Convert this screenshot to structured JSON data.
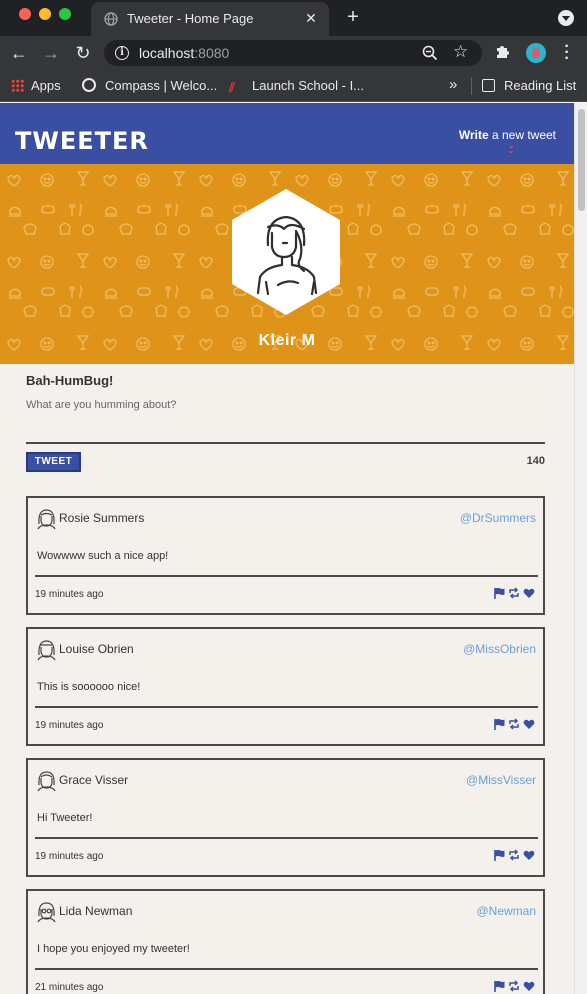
{
  "browser": {
    "tab_title": "Tweeter - Home Page",
    "tab_close": "✕",
    "new_tab": "+",
    "url_host": "localhost",
    "url_port": ":8080",
    "bookmarks": [
      {
        "label": "Apps"
      },
      {
        "label": "Compass | Welco..."
      },
      {
        "label": "Launch School - I..."
      },
      {
        "label": "»"
      },
      {
        "label": "Reading List"
      }
    ]
  },
  "site": {
    "logo": "TWEETER",
    "write_bold": "Write",
    "write_rest": " a new tweet",
    "write_arrow": "⌄⌄"
  },
  "profile": {
    "name": "Kleir M"
  },
  "composer": {
    "title": "Bah-HumBug!",
    "placeholder": "What are you humming about?",
    "button": "TWEET",
    "counter": "140"
  },
  "tweets": [
    {
      "name": "Rosie Summers",
      "handle": "@DrSummers",
      "text": "Wowwww such a nice app!",
      "time": "19 minutes ago"
    },
    {
      "name": "Louise Obrien",
      "handle": "@MissObrien",
      "text": "This is soooooo nice!",
      "time": "19 minutes ago"
    },
    {
      "name": "Grace Visser",
      "handle": "@MissVisser",
      "text": "Hi Tweeter!",
      "time": "19 minutes ago"
    },
    {
      "name": "Lida Newman",
      "handle": "@Newman",
      "text": "I hope you enjoyed my tweeter!",
      "time": "21 minutes ago"
    }
  ],
  "colors": {
    "nav": "#3a4fa1",
    "banner": "#df9419",
    "handle": "#6a9fd8",
    "arrow": "#e94b5a"
  },
  "icons": {
    "tweet_actions": [
      "flag-icon",
      "retweet-icon",
      "heart-icon"
    ]
  }
}
